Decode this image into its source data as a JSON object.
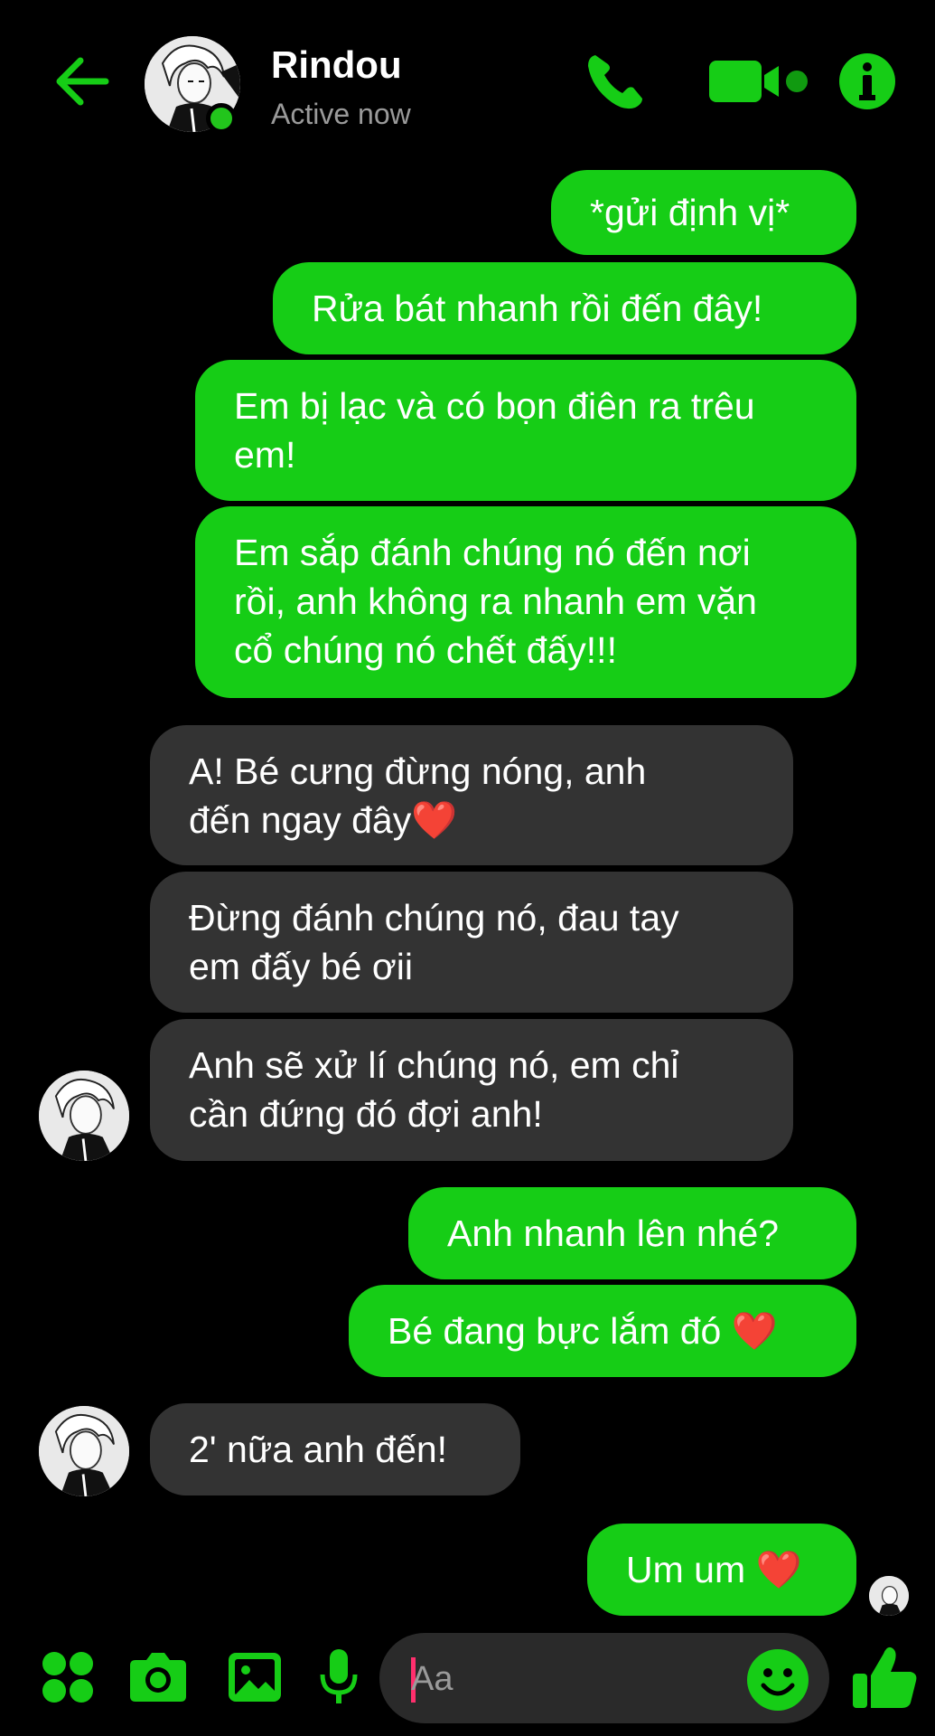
{
  "header": {
    "contact_name": "Rindou",
    "status": "Active now"
  },
  "messages": [
    {
      "sender": "me",
      "text": "*gửi định vị*"
    },
    {
      "sender": "me",
      "text": "Rửa bát nhanh rồi đến đây!"
    },
    {
      "sender": "me",
      "text": "Em bị lạc và có bọn điên ra trêu\nem!"
    },
    {
      "sender": "me",
      "text": "Em sắp đánh chúng nó đến nơi\nrồi, anh không ra nhanh em vặn\ncổ chúng nó chết đấy!!!"
    },
    {
      "sender": "them",
      "text": "A! Bé cưng đừng nóng, anh\nđến ngay đây❤️"
    },
    {
      "sender": "them",
      "text": "Đừng đánh chúng nó, đau tay\nem đấy bé ơii"
    },
    {
      "sender": "them",
      "text": "Anh sẽ xử lí chúng nó, em chỉ\ncần đứng đó đợi anh!"
    },
    {
      "sender": "me",
      "text": "Anh nhanh lên nhé?"
    },
    {
      "sender": "me",
      "text": "Bé đang bực lắm đó ❤️"
    },
    {
      "sender": "them",
      "text": "2' nữa anh đến!"
    },
    {
      "sender": "me",
      "text": "Um um ❤️"
    }
  ],
  "composer": {
    "placeholder": "Aa"
  },
  "colors": {
    "accent": "#16cd16",
    "incoming_bubble": "#333333",
    "background": "#000000",
    "caret": "#ff2f6d"
  },
  "icons": [
    "back-arrow-icon",
    "phone-icon",
    "video-camera-icon",
    "info-icon",
    "menu-dots-icon",
    "camera-icon",
    "image-icon",
    "microphone-icon",
    "emoji-icon",
    "thumbs-up-icon"
  ]
}
